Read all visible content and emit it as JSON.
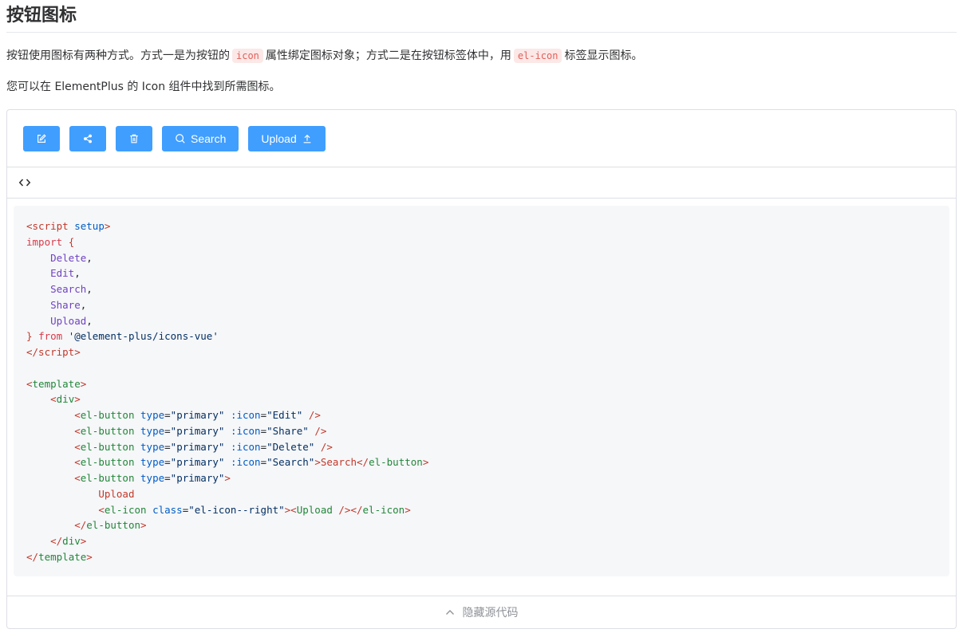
{
  "page": {
    "title": "按钮图标",
    "desc1": {
      "part1": "按钮使用图标有两种方式。方式一是为按钮的",
      "code1": "icon",
      "part2": "属性绑定图标对象；方式二是在按钮标签体中，用",
      "code2": "el-icon",
      "part3": "标签显示图标。"
    },
    "desc2": "您可以在 ElementPlus 的 Icon 组件中找到所需图标。"
  },
  "demo": {
    "buttons": [
      {
        "icon": "edit-icon"
      },
      {
        "icon": "share-icon"
      },
      {
        "icon": "delete-icon"
      },
      {
        "icon": "search-icon",
        "label": "Search"
      },
      {
        "icon": "upload-icon",
        "label": "Upload"
      }
    ],
    "accent_color": "#409eff",
    "code_toggle_icon": "code-brackets-icon",
    "footer": {
      "icon": "chevron-up-icon",
      "label": "隐藏源代码"
    }
  },
  "code": {
    "imports": [
      "Delete",
      "Edit",
      "Search",
      "Share",
      "Upload"
    ],
    "source": "'@element-plus/icons-vue'",
    "btn_type": "primary",
    "icon_edit": "Edit",
    "icon_share": "Share",
    "icon_delete": "Delete",
    "icon_search": "Search",
    "search_text": "Search",
    "upload_text": "Upload",
    "icon_class": "el-icon--right"
  }
}
